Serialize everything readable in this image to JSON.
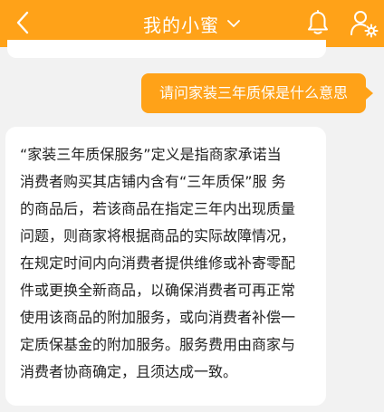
{
  "header": {
    "back_icon": "chevron-left-icon",
    "title": "我的小蜜",
    "title_dropdown_icon": "chevron-down-icon",
    "bell_icon": "bell-icon",
    "user_settings_icon": "user-settings-icon"
  },
  "colors": {
    "brand": "#ffa218",
    "background": "#f2f2f2",
    "bubble_incoming": "#ffffff",
    "text": "#222222"
  },
  "chat": {
    "messages": [
      {
        "from": "user",
        "text": "请问家装三年质保是什么意思"
      },
      {
        "from": "bot",
        "lines": [
          "“家装三年质保服务”定义是指商家承诺当",
          "消费者购买其店铺内含有“三年质保”服 务",
          "的商品后，若该商品在指定三年内出现质量",
          "问题，则商家将根据商品的实际故障情况，",
          "在规定时间内向消费者提供维修或补寄零配",
          "件或更换全新商品，以确保消费者可再正常",
          "使用该商品的附加服务，或向消费者补偿一",
          "定质保基金的附加服务。服务费用由商家与",
          "消费者协商确定，且须达成一致。"
        ]
      }
    ]
  }
}
